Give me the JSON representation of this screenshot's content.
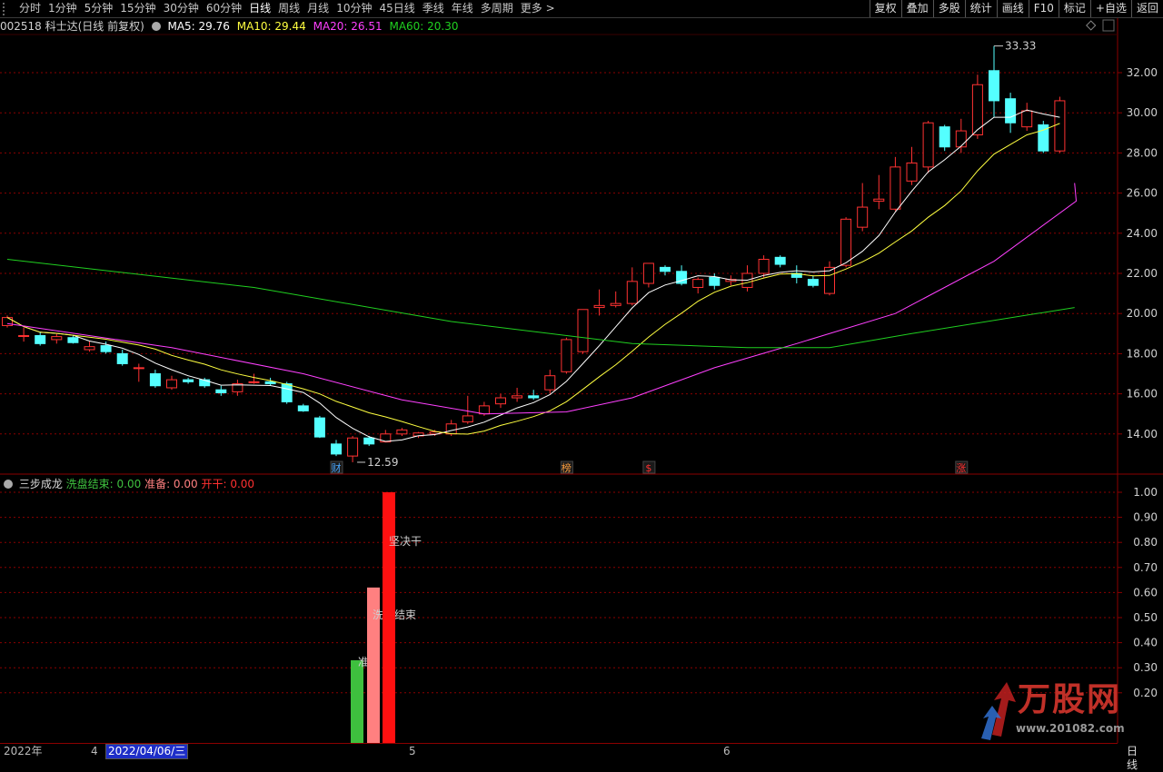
{
  "toolbar": {
    "tabs": [
      "分时",
      "1分钟",
      "5分钟",
      "15分钟",
      "30分钟",
      "60分钟",
      "日线",
      "周线",
      "月线",
      "10分钟",
      "45日线",
      "季线",
      "年线",
      "多周期",
      "更多 >"
    ],
    "active_tab": "日线",
    "right_buttons": [
      "复权",
      "叠加",
      "多股",
      "统计",
      "画线",
      "F10",
      "标记",
      "+自选",
      "返回"
    ]
  },
  "main_info": {
    "stock": "002518 科士达(日线 前复权)",
    "ma5": "MA5: 29.76",
    "ma10": "MA10: 29.44",
    "ma20": "MA20: 26.51",
    "ma60": "MA60: 20.30"
  },
  "colors": {
    "up": "#ff3232",
    "down": "#54ffff",
    "ma5": "#ffffff",
    "ma10": "#ffff40",
    "ma20": "#ff40ff",
    "ma60": "#20d020",
    "grid": "#8b0000"
  },
  "price_axis": [
    "32.00",
    "30.00",
    "28.00",
    "26.00",
    "24.00",
    "22.00",
    "20.00",
    "18.00",
    "16.00",
    "14.00"
  ],
  "annotations": {
    "high": "33.33",
    "low": "12.59"
  },
  "markers": [
    {
      "text": "财",
      "color": "#4aa8ff"
    },
    {
      "text": "榜",
      "color": "#ffa040"
    },
    {
      "text": "$",
      "color": "#ff3030"
    },
    {
      "text": "涨",
      "color": "#ff3030"
    }
  ],
  "indicator_info": {
    "name": "三步成龙",
    "v1": "洗盘结束: 0.00",
    "v2": "准备: 0.00",
    "v3": "开干: 0.00"
  },
  "indicator_axis": [
    "1.00",
    "0.90",
    "0.80",
    "0.70",
    "0.60",
    "0.50",
    "0.40",
    "0.30",
    "0.20"
  ],
  "indicator_bars": [
    {
      "label": "准备",
      "value": 0.33,
      "color": "#3ec03e"
    },
    {
      "label": "洗盘结束",
      "value": 0.62,
      "color": "#ff8080"
    },
    {
      "label": "坚决干",
      "value": 1.0,
      "color": "#ff1010"
    }
  ],
  "date_axis": {
    "year": "2022年",
    "m4": "4",
    "selected": "2022/04/06/三",
    "m5": "5",
    "m6": "6",
    "period": "日线"
  },
  "watermark": {
    "brand": "万股网",
    "url": "www.201082.com"
  },
  "chart_data": {
    "type": "candlestick",
    "series": [
      {
        "o": 19.4,
        "h": 19.9,
        "l": 19.3,
        "c": 19.8
      },
      {
        "o": 18.9,
        "h": 19.3,
        "l": 18.6,
        "c": 18.9
      },
      {
        "o": 18.9,
        "h": 19.1,
        "l": 18.4,
        "c": 18.5
      },
      {
        "o": 18.7,
        "h": 19.0,
        "l": 18.5,
        "c": 18.85
      },
      {
        "o": 18.8,
        "h": 18.9,
        "l": 18.5,
        "c": 18.55
      },
      {
        "o": 18.2,
        "h": 18.6,
        "l": 18.1,
        "c": 18.35
      },
      {
        "o": 18.4,
        "h": 18.6,
        "l": 18.0,
        "c": 18.1
      },
      {
        "o": 18.0,
        "h": 18.2,
        "l": 17.4,
        "c": 17.5
      },
      {
        "o": 17.3,
        "h": 17.5,
        "l": 16.6,
        "c": 17.3
      },
      {
        "o": 17.0,
        "h": 17.2,
        "l": 16.3,
        "c": 16.4
      },
      {
        "o": 16.3,
        "h": 16.9,
        "l": 16.2,
        "c": 16.7
      },
      {
        "o": 16.7,
        "h": 16.8,
        "l": 16.5,
        "c": 16.6
      },
      {
        "o": 16.7,
        "h": 16.8,
        "l": 16.3,
        "c": 16.4
      },
      {
        "o": 16.2,
        "h": 16.4,
        "l": 15.9,
        "c": 16.05
      },
      {
        "o": 16.1,
        "h": 16.7,
        "l": 15.9,
        "c": 16.5
      },
      {
        "o": 16.6,
        "h": 17.0,
        "l": 16.5,
        "c": 16.6
      },
      {
        "o": 16.6,
        "h": 16.8,
        "l": 16.4,
        "c": 16.5
      },
      {
        "o": 16.5,
        "h": 16.6,
        "l": 15.5,
        "c": 15.6
      },
      {
        "o": 15.4,
        "h": 15.5,
        "l": 15.1,
        "c": 15.15
      },
      {
        "o": 14.8,
        "h": 14.9,
        "l": 13.8,
        "c": 13.85
      },
      {
        "o": 13.5,
        "h": 13.7,
        "l": 12.9,
        "c": 13.0
      },
      {
        "o": 12.9,
        "h": 13.9,
        "l": 12.59,
        "c": 13.8
      },
      {
        "o": 13.8,
        "h": 13.9,
        "l": 13.4,
        "c": 13.5
      },
      {
        "o": 13.6,
        "h": 14.2,
        "l": 13.6,
        "c": 14.0
      },
      {
        "o": 14.0,
        "h": 14.3,
        "l": 13.9,
        "c": 14.2
      },
      {
        "o": 13.9,
        "h": 14.1,
        "l": 13.8,
        "c": 14.05
      },
      {
        "o": 14.0,
        "h": 14.2,
        "l": 13.9,
        "c": 14.1
      },
      {
        "o": 14.0,
        "h": 14.7,
        "l": 13.9,
        "c": 14.5
      },
      {
        "o": 14.6,
        "h": 15.9,
        "l": 14.5,
        "c": 14.9
      },
      {
        "o": 15.0,
        "h": 15.6,
        "l": 14.9,
        "c": 15.4
      },
      {
        "o": 15.5,
        "h": 16.0,
        "l": 15.3,
        "c": 15.8
      },
      {
        "o": 15.8,
        "h": 16.3,
        "l": 15.6,
        "c": 15.9
      },
      {
        "o": 15.9,
        "h": 16.2,
        "l": 15.7,
        "c": 15.8
      },
      {
        "o": 16.2,
        "h": 17.2,
        "l": 16.0,
        "c": 16.9
      },
      {
        "o": 17.1,
        "h": 18.8,
        "l": 17.0,
        "c": 18.7
      },
      {
        "o": 18.1,
        "h": 20.1,
        "l": 18.0,
        "c": 20.2
      },
      {
        "o": 20.3,
        "h": 21.2,
        "l": 19.9,
        "c": 20.4
      },
      {
        "o": 20.4,
        "h": 21.1,
        "l": 20.3,
        "c": 20.5
      },
      {
        "o": 20.5,
        "h": 22.3,
        "l": 20.4,
        "c": 21.6
      },
      {
        "o": 21.5,
        "h": 22.5,
        "l": 21.3,
        "c": 22.5
      },
      {
        "o": 22.3,
        "h": 22.4,
        "l": 21.9,
        "c": 22.1
      },
      {
        "o": 22.1,
        "h": 22.4,
        "l": 21.4,
        "c": 21.5
      },
      {
        "o": 21.3,
        "h": 21.8,
        "l": 21.0,
        "c": 21.7
      },
      {
        "o": 21.8,
        "h": 22.0,
        "l": 21.2,
        "c": 21.4
      },
      {
        "o": 21.6,
        "h": 21.9,
        "l": 21.4,
        "c": 21.7
      },
      {
        "o": 21.3,
        "h": 22.4,
        "l": 21.1,
        "c": 22.0
      },
      {
        "o": 22.0,
        "h": 22.9,
        "l": 21.8,
        "c": 22.7
      },
      {
        "o": 22.8,
        "h": 22.9,
        "l": 22.3,
        "c": 22.45
      },
      {
        "o": 22.0,
        "h": 22.4,
        "l": 21.5,
        "c": 21.8
      },
      {
        "o": 21.7,
        "h": 21.9,
        "l": 21.3,
        "c": 21.4
      },
      {
        "o": 21.0,
        "h": 22.6,
        "l": 20.9,
        "c": 22.3
      },
      {
        "o": 22.4,
        "h": 24.8,
        "l": 22.3,
        "c": 24.7
      },
      {
        "o": 24.3,
        "h": 26.5,
        "l": 24.1,
        "c": 25.3
      },
      {
        "o": 25.6,
        "h": 26.9,
        "l": 25.2,
        "c": 25.7
      },
      {
        "o": 25.2,
        "h": 27.8,
        "l": 25.1,
        "c": 27.3
      },
      {
        "o": 26.6,
        "h": 28.3,
        "l": 26.4,
        "c": 27.5
      },
      {
        "o": 27.3,
        "h": 29.6,
        "l": 27.0,
        "c": 29.5
      },
      {
        "o": 29.3,
        "h": 29.4,
        "l": 28.1,
        "c": 28.3
      },
      {
        "o": 28.3,
        "h": 29.7,
        "l": 28.0,
        "c": 29.1
      },
      {
        "o": 28.9,
        "h": 31.9,
        "l": 28.7,
        "c": 31.4
      },
      {
        "o": 32.1,
        "h": 33.33,
        "l": 29.8,
        "c": 30.6
      },
      {
        "o": 30.7,
        "h": 31.0,
        "l": 29.0,
        "c": 29.5
      },
      {
        "o": 29.3,
        "h": 30.5,
        "l": 29.1,
        "c": 30.1
      },
      {
        "o": 29.4,
        "h": 29.6,
        "l": 28.0,
        "c": 28.1
      },
      {
        "o": 28.1,
        "h": 30.8,
        "l": 28.0,
        "c": 30.6
      }
    ]
  }
}
